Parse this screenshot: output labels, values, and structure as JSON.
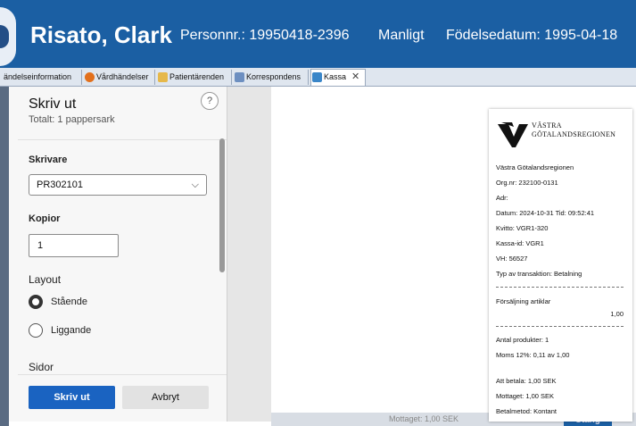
{
  "header": {
    "patient_name": "Risato, Clark",
    "personnr": "Personnr.: 19950418-2396",
    "gender": "Manligt",
    "birthdate": "Födelsedatum: 1995-04-18",
    "background": "#1b5fa3"
  },
  "tabs": [
    {
      "label": "ändelseinformation"
    },
    {
      "label": "Vårdhändelser"
    },
    {
      "label": "Patientärenden"
    },
    {
      "label": "Korrespondens"
    },
    {
      "label": "Kassa",
      "active": true
    }
  ],
  "print_panel": {
    "title": "Skriv ut",
    "subtitle": "Totalt: 1 pappersark",
    "help": "?",
    "printer_label": "Skrivare",
    "printer_value": "PR302101",
    "copies_label": "Kopior",
    "copies_value": "1",
    "layout_label": "Layout",
    "layout_options": [
      {
        "label": "Stående",
        "selected": true
      },
      {
        "label": "Liggande",
        "selected": false
      }
    ],
    "pages_label": "Sidor",
    "print_button": "Skriv ut",
    "cancel_button": "Avbryt",
    "accent": "#1a63c1"
  },
  "receipt": {
    "logo_line1": "VÄSTRA",
    "logo_line2": "GÖTALANDSREGIONEN",
    "lines": [
      "Västra Götalandsregionen",
      "Org.nr: 232100-0131",
      "Adr:",
      "Datum: 2024-10-31 Tid: 09:52:41",
      "Kvitto: VGR1-320",
      "Kassa-id: VGR1",
      "VH: 56527",
      "Typ av transaktion: Betalning"
    ],
    "items_header": "Försäljning artiklar",
    "items_amount": "1,00",
    "summary": [
      "Antal produkter: 1",
      "Moms 12%: 0,11 av 1,00"
    ],
    "payment": [
      "Att betala: 1,00 SEK",
      "Mottaget: 1,00 SEK",
      "Betalmetod: Kontant"
    ]
  },
  "background_bar": {
    "text": "Mottaget: 1,00 SEK",
    "button": "Stäng"
  }
}
